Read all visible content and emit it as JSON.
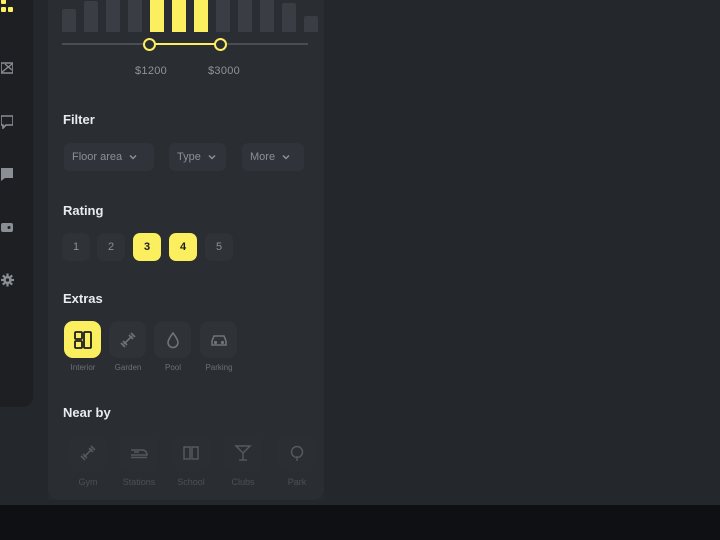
{
  "colors": {
    "accent": "#fbee5f",
    "panel": "#2a2d32",
    "background": "#24272c"
  },
  "sidebar": {
    "icons": [
      "grid-icon",
      "ticket-icon",
      "chat-icon",
      "message-icon",
      "wallet-icon",
      "gear-icon"
    ]
  },
  "price": {
    "min_label": "$1200",
    "max_label": "$3000",
    "histogram_levels": [
      0.45,
      0.6,
      0.75,
      0.95,
      1.0,
      1.0,
      1.0,
      0.95,
      0.8,
      0.7,
      0.55,
      0.3
    ],
    "selected_bars": [
      4,
      5,
      6
    ]
  },
  "filter": {
    "title": "Filter",
    "dropdowns": [
      {
        "label": "Floor area"
      },
      {
        "label": "Type"
      },
      {
        "label": "More"
      }
    ]
  },
  "rating": {
    "title": "Rating",
    "options": [
      "1",
      "2",
      "3",
      "4",
      "5"
    ],
    "selected": [
      "3",
      "4"
    ]
  },
  "extras": {
    "title": "Extras",
    "items": [
      {
        "label": "Interior",
        "icon": "layout-icon",
        "selected": true
      },
      {
        "label": "Garden",
        "icon": "dumbbell-icon",
        "selected": false
      },
      {
        "label": "Pool",
        "icon": "drop-icon",
        "selected": false
      },
      {
        "label": "Parking",
        "icon": "car-icon",
        "selected": false
      }
    ]
  },
  "nearby": {
    "title": "Near by",
    "items": [
      {
        "label": "Gym",
        "icon": "dumbbell-icon"
      },
      {
        "label": "Stations",
        "icon": "train-icon"
      },
      {
        "label": "School",
        "icon": "book-icon"
      },
      {
        "label": "Clubs",
        "icon": "cocktail-icon"
      },
      {
        "label": "Park",
        "icon": "tree-icon"
      }
    ]
  }
}
